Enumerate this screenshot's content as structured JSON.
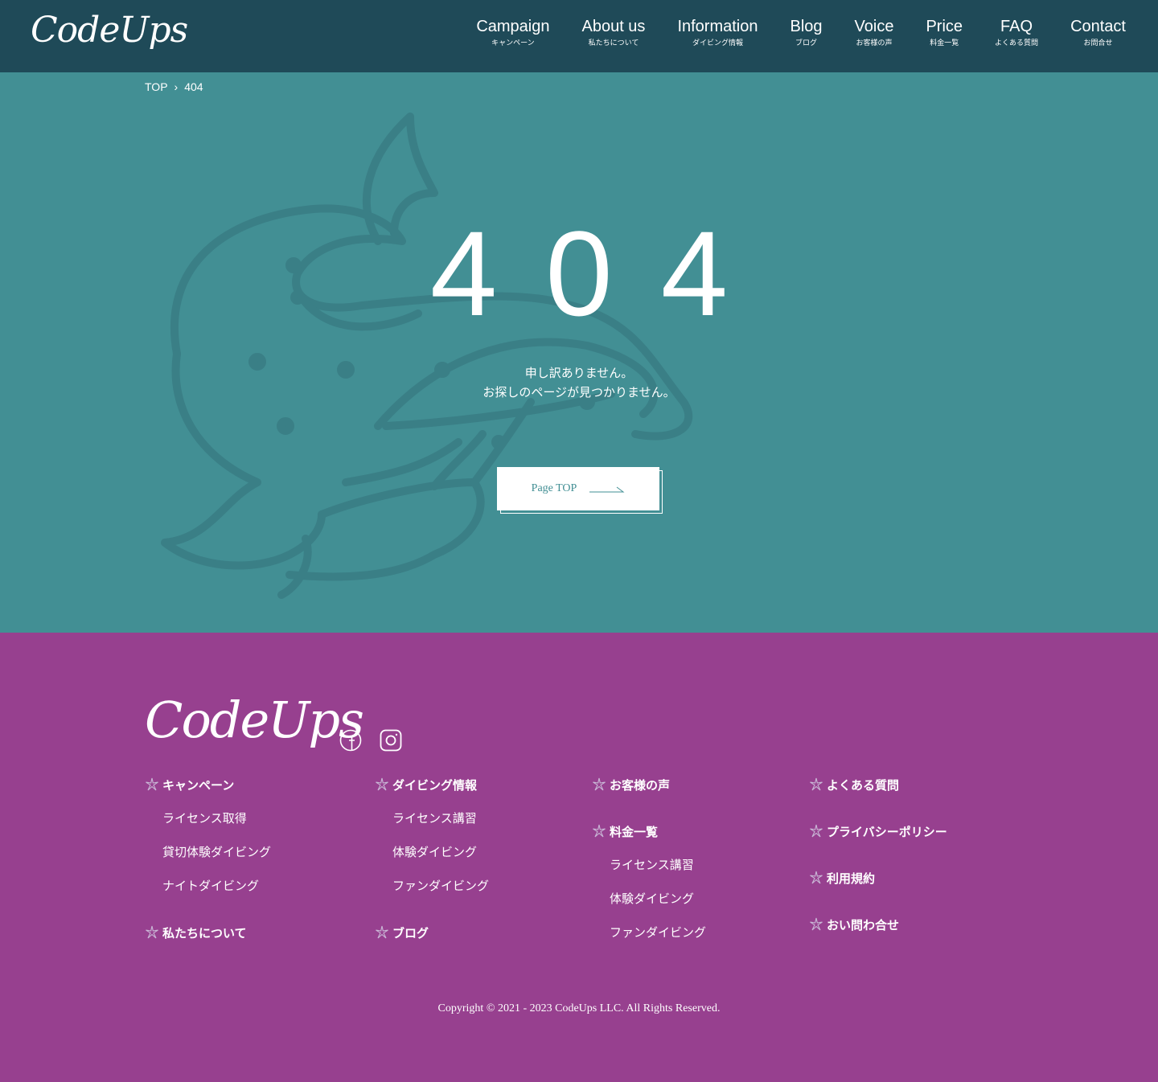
{
  "header": {
    "logo": "CodeUps",
    "nav": [
      {
        "en": "Campaign",
        "ja": "キャンペーン"
      },
      {
        "en": "About us",
        "ja": "私たちについて"
      },
      {
        "en": "Information",
        "ja": "ダイビング情報"
      },
      {
        "en": "Blog",
        "ja": "ブログ"
      },
      {
        "en": "Voice",
        "ja": "お客様の声"
      },
      {
        "en": "Price",
        "ja": "料金一覧"
      },
      {
        "en": "FAQ",
        "ja": "よくある質問"
      },
      {
        "en": "Contact",
        "ja": "お問合せ"
      }
    ]
  },
  "breadcrumb": {
    "home": "TOP",
    "separator": "›",
    "current": "404"
  },
  "error": {
    "code": "404",
    "line1": "申し訳ありません。",
    "line2": "お探しのページが見つかりません。",
    "button_label": "Page TOP"
  },
  "footer": {
    "logo": "CodeUps",
    "columns": [
      {
        "groups": [
          {
            "heading": "キャンペーン",
            "items": [
              "ライセンス取得",
              "貸切体験ダイビング",
              "ナイトダイビング"
            ]
          },
          {
            "heading": "私たちについて",
            "items": []
          }
        ]
      },
      {
        "groups": [
          {
            "heading": "ダイビング情報",
            "items": [
              "ライセンス講習",
              "体験ダイビング",
              "ファンダイビング"
            ]
          },
          {
            "heading": "ブログ",
            "items": []
          }
        ]
      },
      {
        "groups": [
          {
            "heading": "お客様の声",
            "items": []
          },
          {
            "heading": "料金一覧",
            "items": [
              "ライセンス講習",
              "体験ダイビング",
              "ファンダイビング"
            ]
          }
        ]
      },
      {
        "groups": [
          {
            "heading": "よくある質問",
            "items": []
          },
          {
            "heading": "プライバシーポリシー",
            "items": []
          },
          {
            "heading": "利用規約",
            "items": []
          },
          {
            "heading": "おい問わ合せ",
            "items": []
          }
        ]
      }
    ],
    "copyright": "Copyright © 2021 - 2023 CodeUps LLC. All Rights Reserved."
  },
  "colors": {
    "header_bg": "#1f4a58",
    "main_bg": "#428f94",
    "footer_bg": "#97408f",
    "whale_stroke": "#3a7f86"
  },
  "icons": [
    "facebook-icon",
    "instagram-icon",
    "starfish-icon",
    "arrow-right-icon",
    "whale-illustration"
  ]
}
